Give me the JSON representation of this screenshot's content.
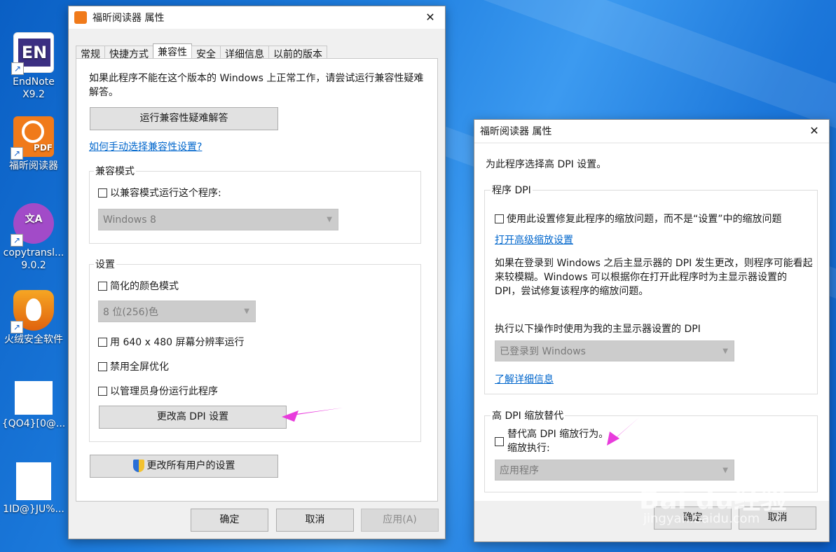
{
  "desktop": {
    "icons": [
      {
        "label": "EndNote X9.2",
        "glyph": "EN"
      },
      {
        "label": "福昕阅读器",
        "glyph": "PDF"
      },
      {
        "label": "copytransl... 9.0.2",
        "glyph": "文A"
      },
      {
        "label": "火绒安全软件",
        "glyph": ""
      },
      {
        "label": "{QO4}[0@...",
        "glyph": ""
      },
      {
        "label": "1ID@}JU%...",
        "glyph": ""
      }
    ]
  },
  "main_window": {
    "title": "福昕阅读器 属性",
    "tabs": [
      "常规",
      "快捷方式",
      "兼容性",
      "安全",
      "详细信息",
      "以前的版本"
    ],
    "active_tab": "兼容性",
    "intro": "如果此程序不能在这个版本的 Windows 上正常工作，请尝试运行兼容性疑难解答。",
    "troubleshooter_button": "运行兼容性疑难解答",
    "manual_link": "如何手动选择兼容性设置?",
    "compat_group": {
      "title": "兼容模式",
      "checkbox": "以兼容模式运行这个程序:",
      "select_value": "Windows 8"
    },
    "settings_group": {
      "title": "设置",
      "reduced_color": "简化的颜色模式",
      "color_select": "8 位(256)色",
      "run_640": "用 640 x 480 屏幕分辨率运行",
      "disable_fullscreen": "禁用全屏优化",
      "run_admin": "以管理员身份运行此程序",
      "dpi_button": "更改高 DPI 设置"
    },
    "all_users_button": "更改所有用户的设置",
    "ok": "确定",
    "cancel": "取消",
    "apply": "应用(A)"
  },
  "dpi_window": {
    "title": "福昕阅读器 属性",
    "heading": "为此程序选择高 DPI 设置。",
    "program_dpi": {
      "title": "程序 DPI",
      "checkbox": "使用此设置修复此程序的缩放问题，而不是“设置”中的缩放问题",
      "advanced_link": "打开高级缩放设置",
      "description": "如果在登录到 Windows 之后主显示器的 DPI 发生更改，则程序可能看起来较模糊。Windows 可以根据你在打开此程序时为主显示器设置的 DPI，尝试修复该程序的缩放问题。",
      "when_label": "执行以下操作时使用为我的主显示器设置的 DPI",
      "when_select": "已登录到 Windows",
      "learn_link": "了解详细信息"
    },
    "override": {
      "title": "高 DPI 缩放替代",
      "checkbox": "替代高 DPI 缩放行为。",
      "checkbox_line2": "缩放执行:",
      "select": "应用程序"
    },
    "ok": "确定",
    "cancel": "取消"
  },
  "watermark": {
    "brand": "Bai du经验",
    "url": "jingyan.baidu.com"
  },
  "colors": {
    "accent_link": "#0066cc",
    "arrow": "#e83cdc",
    "desktop": "#1f7fe0"
  }
}
